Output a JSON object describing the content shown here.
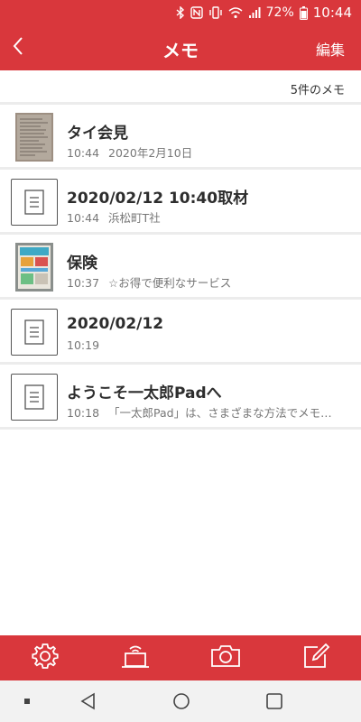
{
  "status_bar": {
    "battery": "72%",
    "time": "10:44",
    "icons": [
      "bluetooth-icon",
      "nfc-icon",
      "vibrate-icon",
      "wifi-icon",
      "signal-icon",
      "battery-icon"
    ]
  },
  "header": {
    "back_icon": "chevron-left-icon",
    "title": "メモ",
    "edit_label": "編集"
  },
  "count_label": "5件のメモ",
  "memos": [
    {
      "title": "タイ会見",
      "time": "10:44",
      "subtitle": "2020年2月10日",
      "thumbnail": "photo-handwritten"
    },
    {
      "title": "2020/02/12 10:40取材",
      "time": "10:44",
      "subtitle": "浜松町T社",
      "thumbnail": "document-icon"
    },
    {
      "title": "保険",
      "time": "10:37",
      "subtitle": "☆お得で便利なサービス",
      "thumbnail": "photo-brochure"
    },
    {
      "title": "2020/02/12",
      "time": "10:19",
      "subtitle": "",
      "thumbnail": "document-icon"
    },
    {
      "title": "ようこそ一太郎Padへ",
      "time": "10:18",
      "subtitle": "「一太郎Pad」は、さまざまな方法でメモ…",
      "thumbnail": "document-icon"
    }
  ],
  "toolbar": {
    "items": [
      "settings-icon",
      "pc-transfer-icon",
      "camera-icon",
      "new-memo-icon"
    ]
  },
  "nav_bar": {
    "items": [
      "recent-dot-icon",
      "back-triangle-icon",
      "home-circle-icon",
      "overview-square-icon"
    ]
  },
  "colors": {
    "accent": "#d9373c",
    "divider": "#ececec",
    "subtext": "#777777"
  }
}
